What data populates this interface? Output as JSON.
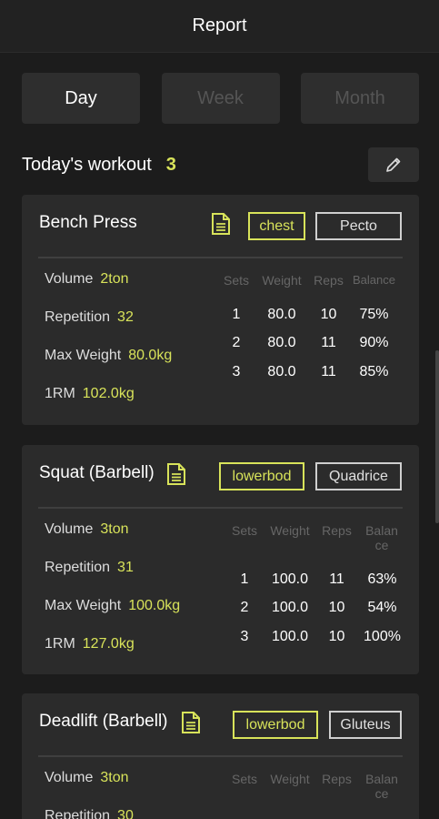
{
  "header": {
    "title": "Report"
  },
  "tabs": [
    {
      "label": "Day",
      "active": true
    },
    {
      "label": "Week",
      "active": false
    },
    {
      "label": "Month",
      "active": false
    }
  ],
  "workout": {
    "label": "Today's workout",
    "count": "3",
    "edit_icon": "pencil-icon"
  },
  "colors": {
    "accent": "#d8e35a",
    "background": "#1c1c1c",
    "card": "#2b2b2b"
  },
  "columns": {
    "sets": "Sets",
    "weight": "Weight",
    "reps": "Reps",
    "balance": "Balance"
  },
  "stat_labels": {
    "volume": "Volume",
    "repetition": "Repetition",
    "max_weight": "Max Weight",
    "one_rm": "1RM"
  },
  "exercises": [
    {
      "name": "Bench Press",
      "muscle": "chest",
      "sub_muscle": "Pecto",
      "volume": "2ton",
      "repetition": "32",
      "max_weight": "80.0kg",
      "one_rm": "102.0kg",
      "sets": [
        {
          "set": "1",
          "weight": "80.0",
          "reps": "10",
          "balance": "75%"
        },
        {
          "set": "2",
          "weight": "80.0",
          "reps": "11",
          "balance": "90%"
        },
        {
          "set": "3",
          "weight": "80.0",
          "reps": "11",
          "balance": "85%"
        }
      ]
    },
    {
      "name": "Squat (Barbell)",
      "muscle": "lowerbod",
      "sub_muscle": "Quadrice",
      "volume": "3ton",
      "repetition": "31",
      "max_weight": "100.0kg",
      "one_rm": "127.0kg",
      "sets": [
        {
          "set": "1",
          "weight": "100.0",
          "reps": "11",
          "balance": "63%"
        },
        {
          "set": "2",
          "weight": "100.0",
          "reps": "10",
          "balance": "54%"
        },
        {
          "set": "3",
          "weight": "100.0",
          "reps": "10",
          "balance": "100%"
        }
      ]
    },
    {
      "name": "Deadlift (Barbell)",
      "muscle": "lowerbod",
      "sub_muscle": "Gluteus",
      "volume": "3ton",
      "repetition": "30"
    }
  ]
}
